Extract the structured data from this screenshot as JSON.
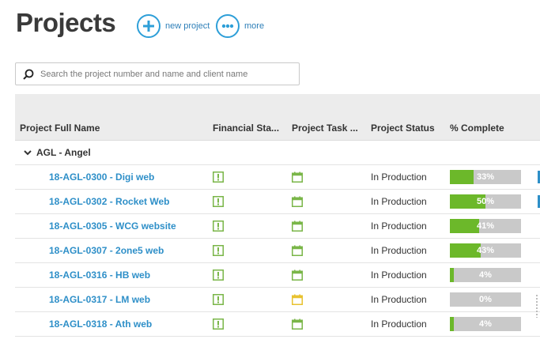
{
  "header": {
    "title": "Projects",
    "new_project_label": "new project",
    "more_label": "more"
  },
  "search": {
    "placeholder": "Search the project number and name and client name"
  },
  "table": {
    "columns": [
      "Project Full Name",
      "Financial Sta...",
      "Project Task ...",
      "Project Status",
      "% Complete"
    ],
    "group": "AGL - Angel",
    "rows": [
      {
        "name": "18-AGL-0300 - Digi web",
        "status": "In Production",
        "complete_pct": 33,
        "complete_label": "33%",
        "task_icon_color": "#7ab648"
      },
      {
        "name": "18-AGL-0302 - Rocket Web",
        "status": "In Production",
        "complete_pct": 50,
        "complete_label": "50%",
        "task_icon_color": "#7ab648"
      },
      {
        "name": "18-AGL-0305 - WCG website",
        "status": "In Production",
        "complete_pct": 41,
        "complete_label": "41%",
        "task_icon_color": "#7ab648"
      },
      {
        "name": "18-AGL-0307 - 2one5 web",
        "status": "In Production",
        "complete_pct": 43,
        "complete_label": "43%",
        "task_icon_color": "#7ab648"
      },
      {
        "name": "18-AGL-0316 - HB web",
        "status": "In Production",
        "complete_pct": 4,
        "complete_label": "4%",
        "task_icon_color": "#7ab648"
      },
      {
        "name": "18-AGL-0317 - LM web",
        "status": "In Production",
        "complete_pct": 0,
        "complete_label": "0%",
        "task_icon_color": "#e8c230"
      },
      {
        "name": "18-AGL-0318 - Ath web",
        "status": "In Production",
        "complete_pct": 4,
        "complete_label": "4%",
        "task_icon_color": "#7ab648"
      }
    ]
  },
  "colors": {
    "accent": "#2e9fd8",
    "link": "#2e8fc8",
    "progress_fill": "#6cb82a",
    "progress_track": "#c9c9c9",
    "financial_icon": "#7ab648"
  },
  "icons": {
    "new_project": "plus-circle-icon",
    "more": "ellipsis-circle-icon",
    "search": "search-icon",
    "group_toggle": "chevron-down-icon",
    "financial_status": "exclamation-square-icon",
    "project_task": "calendar-icon"
  }
}
